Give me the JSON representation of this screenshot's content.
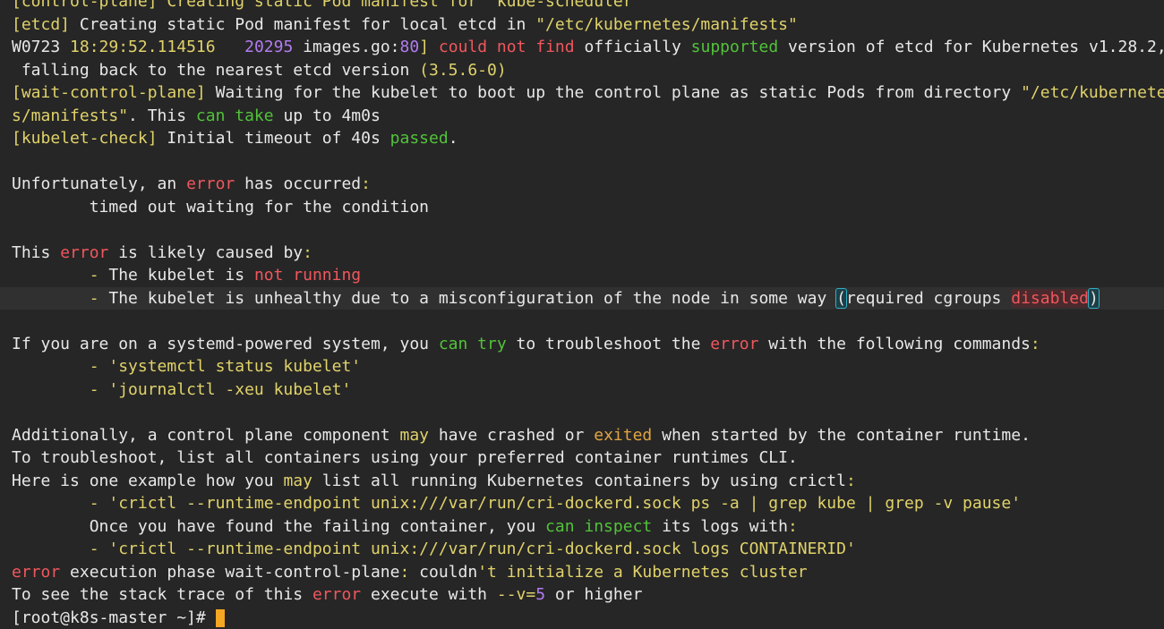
{
  "colors": {
    "background": "#262626",
    "text": "#e8e8e8",
    "yellow": "#e0d26a",
    "red": "#f0575d",
    "green": "#52c23a",
    "purple": "#b27cf0",
    "orange": "#e2a542",
    "cursor": "#f5a623",
    "bracket_match": "#2fb0c8"
  },
  "lines": [
    {
      "id": "control-plane-scheduler",
      "segments": [
        {
          "t": "[control-plane] Creating static Pod manifest for \"kube-scheduler\"",
          "c": "yellow"
        }
      ]
    },
    {
      "id": "etcd-manifest",
      "segments": [
        {
          "t": "[etcd]",
          "c": "yellow"
        },
        {
          "t": " Creating static Pod manifest for local etcd in ",
          "c": "default"
        },
        {
          "t": "\"/etc/kubernetes/manifests\"",
          "c": "yellow"
        }
      ]
    },
    {
      "id": "warning-etcd-version",
      "segments": [
        {
          "t": "W0723 ",
          "c": "default"
        },
        {
          "t": "18:29:52.114516",
          "c": "yellow"
        },
        {
          "t": "   ",
          "c": "default"
        },
        {
          "t": "20295",
          "c": "purple"
        },
        {
          "t": " images.go:",
          "c": "default"
        },
        {
          "t": "80",
          "c": "purple"
        },
        {
          "t": "]",
          "c": "yellow"
        },
        {
          "t": " ",
          "c": "default"
        },
        {
          "t": "could not find",
          "c": "red"
        },
        {
          "t": " officially ",
          "c": "default"
        },
        {
          "t": "supported",
          "c": "green"
        },
        {
          "t": " version of etcd for Kubernetes v1.28.2,",
          "c": "default"
        }
      ]
    },
    {
      "id": "warning-etcd-fallback",
      "segments": [
        {
          "t": " falling back to the nearest etcd version ",
          "c": "default"
        },
        {
          "t": "(3.5.6-0)",
          "c": "yellow"
        }
      ]
    },
    {
      "id": "wait-control-plane",
      "segments": [
        {
          "t": "[wait-control-plane]",
          "c": "yellow"
        },
        {
          "t": " Waiting for the kubelet to boot up the control plane as static Pods from directory ",
          "c": "default"
        },
        {
          "t": "\"/etc/kubernete",
          "c": "yellow"
        }
      ]
    },
    {
      "id": "wait-control-plane-cont",
      "segments": [
        {
          "t": "s/manifests\"",
          "c": "yellow"
        },
        {
          "t": ". This ",
          "c": "default"
        },
        {
          "t": "can take",
          "c": "green"
        },
        {
          "t": " up to 4m0s",
          "c": "default"
        }
      ]
    },
    {
      "id": "kubelet-check",
      "segments": [
        {
          "t": "[kubelet-check]",
          "c": "yellow"
        },
        {
          "t": " Initial timeout of 40s ",
          "c": "default"
        },
        {
          "t": "passed",
          "c": "green"
        },
        {
          "t": ".",
          "c": "default"
        }
      ]
    },
    {
      "id": "blank-1",
      "segments": []
    },
    {
      "id": "error-occurred",
      "segments": [
        {
          "t": "Unfortunately, an ",
          "c": "default"
        },
        {
          "t": "error",
          "c": "red"
        },
        {
          "t": " has occurred",
          "c": "default"
        },
        {
          "t": ":",
          "c": "yellow"
        }
      ]
    },
    {
      "id": "timed-out",
      "segments": [
        {
          "t": "        timed out waiting for the condition",
          "c": "default"
        }
      ]
    },
    {
      "id": "blank-2",
      "segments": []
    },
    {
      "id": "likely-caused",
      "segments": [
        {
          "t": "This ",
          "c": "default"
        },
        {
          "t": "error",
          "c": "red"
        },
        {
          "t": " is likely caused by",
          "c": "default"
        },
        {
          "t": ":",
          "c": "yellow"
        }
      ]
    },
    {
      "id": "kubelet-not-running",
      "segments": [
        {
          "t": "        - ",
          "c": "yellow"
        },
        {
          "t": "The kubelet is ",
          "c": "default"
        },
        {
          "t": "not running",
          "c": "red"
        }
      ]
    },
    {
      "id": "kubelet-unhealthy",
      "highlight": true,
      "segments": [
        {
          "t": "        - ",
          "c": "yellow"
        },
        {
          "t": "The kubelet is unhealthy due to a misconfiguration of the node in some way ",
          "c": "default"
        },
        {
          "t": "(",
          "c": "default",
          "mark": "bracket"
        },
        {
          "t": "required cgroups ",
          "c": "default"
        },
        {
          "t": "disabled",
          "c": "red",
          "mark": "disabled"
        },
        {
          "t": ")",
          "c": "default",
          "mark": "bracket"
        }
      ]
    },
    {
      "id": "blank-3",
      "segments": []
    },
    {
      "id": "systemd-troubleshoot",
      "segments": [
        {
          "t": "If you are on a systemd-powered system, you ",
          "c": "default"
        },
        {
          "t": "can try",
          "c": "green"
        },
        {
          "t": " to troubleshoot the ",
          "c": "default"
        },
        {
          "t": "error",
          "c": "red"
        },
        {
          "t": " with the following commands",
          "c": "default"
        },
        {
          "t": ":",
          "c": "yellow"
        }
      ]
    },
    {
      "id": "cmd-systemctl",
      "segments": [
        {
          "t": "        - 'systemctl status kubelet'",
          "c": "yellow"
        }
      ]
    },
    {
      "id": "cmd-journalctl",
      "segments": [
        {
          "t": "        - 'journalctl -xeu kubelet'",
          "c": "yellow"
        }
      ]
    },
    {
      "id": "blank-4",
      "segments": []
    },
    {
      "id": "additionally",
      "segments": [
        {
          "t": "Additionally, a control plane component ",
          "c": "default"
        },
        {
          "t": "may",
          "c": "yellow"
        },
        {
          "t": " have crashed or ",
          "c": "default"
        },
        {
          "t": "exited",
          "c": "orange"
        },
        {
          "t": " when started by the container runtime.",
          "c": "default"
        }
      ]
    },
    {
      "id": "to-troubleshoot",
      "segments": [
        {
          "t": "To troubleshoot, list all containers using your preferred container runtimes CLI.",
          "c": "default"
        }
      ]
    },
    {
      "id": "example-crictl",
      "segments": [
        {
          "t": "Here is one example how you ",
          "c": "default"
        },
        {
          "t": "may",
          "c": "yellow"
        },
        {
          "t": " list all running Kubernetes containers by using crictl",
          "c": "default"
        },
        {
          "t": ":",
          "c": "yellow"
        }
      ]
    },
    {
      "id": "cmd-crictl-ps",
      "segments": [
        {
          "t": "        - 'crictl --runtime-endpoint unix:///var/run/cri-dockerd.sock ps -a | grep kube | grep -v pause'",
          "c": "yellow"
        }
      ]
    },
    {
      "id": "found-failing",
      "segments": [
        {
          "t": "        Once you have found the failing container, you ",
          "c": "default"
        },
        {
          "t": "can inspect",
          "c": "green"
        },
        {
          "t": " its logs with",
          "c": "default"
        },
        {
          "t": ":",
          "c": "yellow"
        }
      ]
    },
    {
      "id": "cmd-crictl-logs",
      "segments": [
        {
          "t": "        - 'crictl --runtime-endpoint unix:///var/run/cri-dockerd.sock logs CONTAINERID'",
          "c": "yellow"
        }
      ]
    },
    {
      "id": "error-execution",
      "segments": [
        {
          "t": "error",
          "c": "red"
        },
        {
          "t": " execution phase wait-control-plane",
          "c": "default"
        },
        {
          "t": ":",
          "c": "yellow"
        },
        {
          "t": " couldn",
          "c": "default"
        },
        {
          "t": "'t initialize a Kubernetes cluster",
          "c": "yellow"
        }
      ]
    },
    {
      "id": "stack-trace",
      "segments": [
        {
          "t": "To see the stack trace of this ",
          "c": "default"
        },
        {
          "t": "error",
          "c": "red"
        },
        {
          "t": " execute with ",
          "c": "default"
        },
        {
          "t": "--v=",
          "c": "yellow"
        },
        {
          "t": "5",
          "c": "purple"
        },
        {
          "t": " or higher",
          "c": "default"
        }
      ]
    },
    {
      "id": "prompt",
      "prompt": true,
      "segments": [
        {
          "t": "[root@k8s-master ~]# ",
          "c": "default"
        }
      ]
    }
  ]
}
